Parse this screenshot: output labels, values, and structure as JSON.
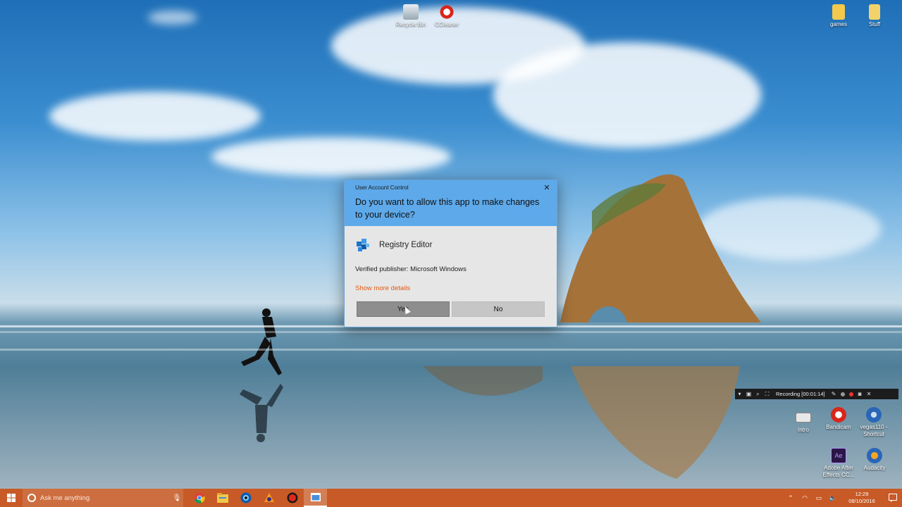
{
  "desktop": {
    "icons": [
      {
        "label": "Recycle Bin",
        "icon": "recycle-bin-icon"
      },
      {
        "label": "CCleaner",
        "icon": "ccleaner-icon"
      },
      {
        "label": "games",
        "icon": "folder-icon"
      },
      {
        "label": "Stuff",
        "icon": "folder-icon"
      },
      {
        "label": "Intro",
        "icon": "file-icon"
      },
      {
        "label": "Bandicam",
        "icon": "bandicam-icon"
      },
      {
        "label": "vegas110 - Shortcut",
        "icon": "vegas-icon"
      },
      {
        "label": "Adobe After Effects CC...",
        "icon": "after-effects-icon"
      },
      {
        "label": "Audacity",
        "icon": "audacity-icon"
      }
    ]
  },
  "uac": {
    "title": "User Account Control",
    "question": "Do you want to allow this app to make changes to your device?",
    "app_name": "Registry Editor",
    "publisher": "Verified publisher: Microsoft Windows",
    "details_link": "Show more details",
    "yes_label": "Yes",
    "no_label": "No",
    "header_color": "#5da9e9"
  },
  "recording": {
    "status": "Recording [00:01:14]"
  },
  "taskbar": {
    "search_placeholder": "Ask me anything",
    "color": "#c75a26",
    "pinned": [
      "chrome-icon",
      "file-explorer-icon",
      "edge-icon",
      "media-app-icon",
      "bandicam-icon",
      "active-window-icon"
    ],
    "clock_time": "12:29",
    "clock_date": "08/10/2016"
  }
}
